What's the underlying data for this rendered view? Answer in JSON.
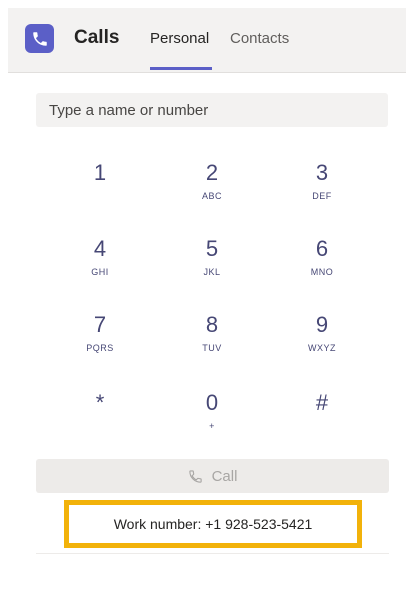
{
  "header": {
    "app_title": "Calls",
    "tabs": [
      {
        "label": "Personal",
        "active": true
      },
      {
        "label": "Contacts",
        "active": false
      }
    ],
    "app_icon": "phone-icon"
  },
  "search": {
    "placeholder": "Type a name or number",
    "value": ""
  },
  "dialpad": {
    "keys": [
      {
        "digit": "1",
        "letters": ""
      },
      {
        "digit": "2",
        "letters": "ABC"
      },
      {
        "digit": "3",
        "letters": "DEF"
      },
      {
        "digit": "4",
        "letters": "GHI"
      },
      {
        "digit": "5",
        "letters": "JKL"
      },
      {
        "digit": "6",
        "letters": "MNO"
      },
      {
        "digit": "7",
        "letters": "PQRS"
      },
      {
        "digit": "8",
        "letters": "TUV"
      },
      {
        "digit": "9",
        "letters": "WXYZ"
      },
      {
        "digit": "*",
        "letters": ""
      },
      {
        "digit": "0",
        "letters": "+"
      },
      {
        "digit": "#",
        "letters": ""
      }
    ]
  },
  "call_button": {
    "label": "Call",
    "icon": "phone-icon",
    "enabled": false
  },
  "work_number": {
    "text": "Work number: +1 928-523-5421"
  },
  "colors": {
    "accent": "#5b5fc7",
    "digit": "#464775",
    "highlight_border": "#f2b20a"
  }
}
